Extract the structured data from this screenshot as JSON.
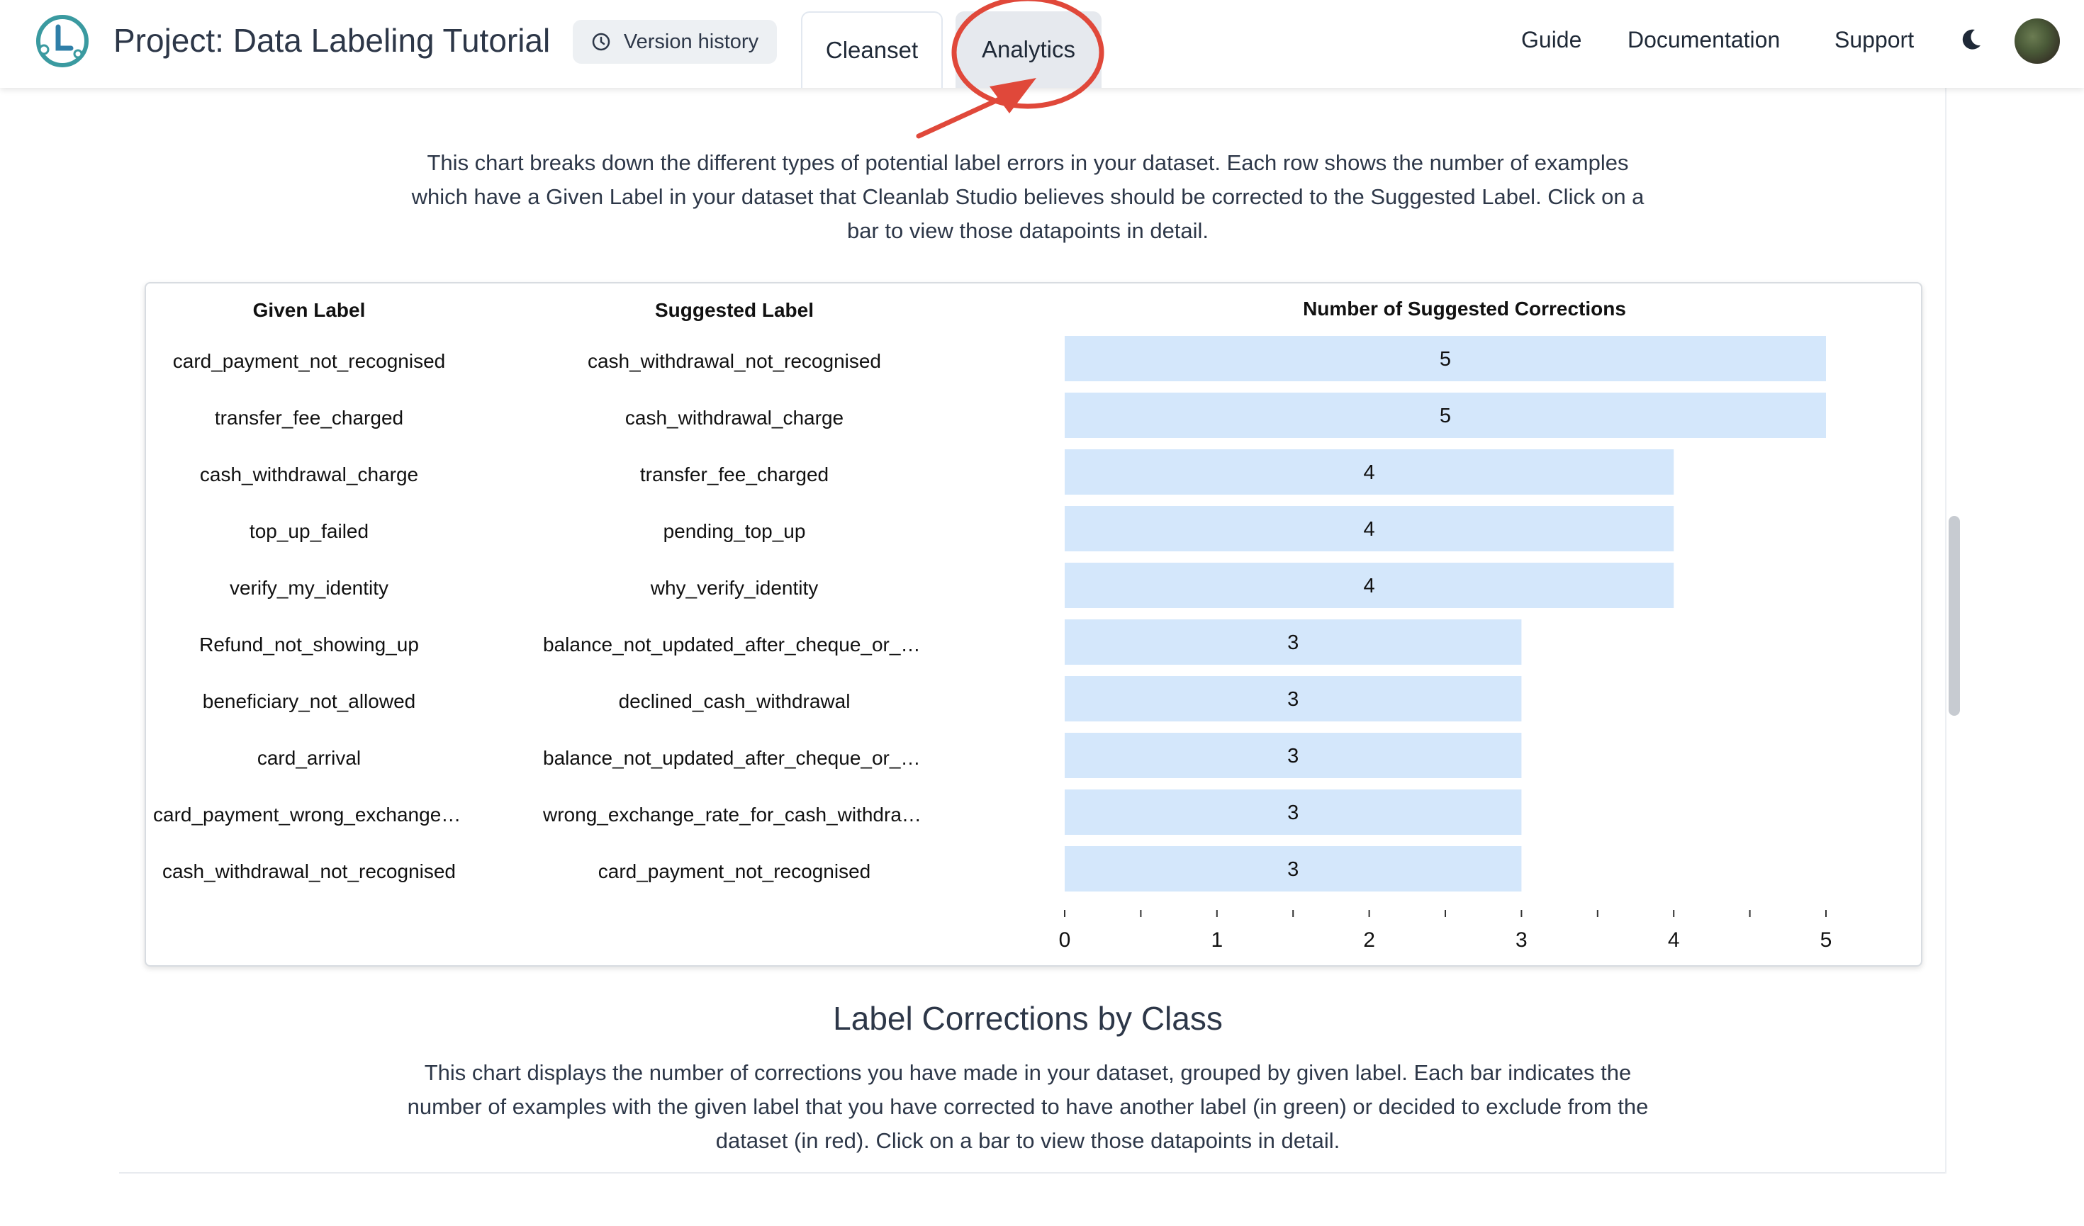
{
  "header": {
    "project_title": "Project: Data Labeling Tutorial",
    "version_history_label": "Version history",
    "tabs": [
      {
        "label": "Cleanset"
      },
      {
        "label": "Analytics"
      }
    ],
    "nav": {
      "guide": "Guide",
      "documentation": "Documentation",
      "support": "Support"
    }
  },
  "intro_text": "This chart breaks down the different types of potential label errors in your dataset. Each row shows the number of examples which have a Given Label in your dataset that Cleanlab Studio believes should be corrected to the Suggested Label. Click on a bar to view those datapoints in detail.",
  "table": {
    "headers": {
      "given": "Given Label",
      "suggested": "Suggested Label",
      "count": "Number of Suggested Corrections"
    },
    "rows": [
      {
        "given": "card_payment_not_recognised",
        "suggested": "cash_withdrawal_not_recognised",
        "count": 5
      },
      {
        "given": "transfer_fee_charged",
        "suggested": "cash_withdrawal_charge",
        "count": 5
      },
      {
        "given": "cash_withdrawal_charge",
        "suggested": "transfer_fee_charged",
        "count": 4
      },
      {
        "given": "top_up_failed",
        "suggested": "pending_top_up",
        "count": 4
      },
      {
        "given": "verify_my_identity",
        "suggested": "why_verify_identity",
        "count": 4
      },
      {
        "given": "Refund_not_showing_up",
        "suggested": "balance_not_updated_after_cheque_or_cash...",
        "count": 3
      },
      {
        "given": "beneficiary_not_allowed",
        "suggested": "declined_cash_withdrawal",
        "count": 3
      },
      {
        "given": "card_arrival",
        "suggested": "balance_not_updated_after_cheque_or_cash...",
        "count": 3
      },
      {
        "given": "card_payment_wrong_exchange_rate",
        "suggested": "wrong_exchange_rate_for_cash_withdrawal",
        "count": 3
      },
      {
        "given": "cash_withdrawal_not_recognised",
        "suggested": "card_payment_not_recognised",
        "count": 3
      }
    ]
  },
  "chart_data": {
    "type": "bar",
    "orientation": "horizontal",
    "title": "Number of Suggested Corrections",
    "categories": [
      "card_payment_not_recognised → cash_withdrawal_not_recognised",
      "transfer_fee_charged → cash_withdrawal_charge",
      "cash_withdrawal_charge → transfer_fee_charged",
      "top_up_failed → pending_top_up",
      "verify_my_identity → why_verify_identity",
      "Refund_not_showing_up → balance_not_updated_after_cheque_or_cash...",
      "beneficiary_not_allowed → declined_cash_withdrawal",
      "card_arrival → balance_not_updated_after_cheque_or_cash...",
      "card_payment_wrong_exchange_rate → wrong_exchange_rate_for_cash_withdrawal",
      "cash_withdrawal_not_recognised → card_payment_not_recognised"
    ],
    "values": [
      5,
      5,
      4,
      4,
      4,
      3,
      3,
      3,
      3,
      3
    ],
    "xlim": [
      0,
      5
    ],
    "xticks": [
      0,
      1,
      2,
      3,
      4,
      5
    ],
    "grid": false,
    "bar_color": "#d4e7fb"
  },
  "section2": {
    "title": "Label Corrections by Class",
    "description": "This chart displays the number of corrections you have made in your dataset, grouped by given label. Each bar indicates the number of examples with the given label that you have corrected to have another label (in green) or decided to exclude from the dataset (in red). Click on a bar to view those datapoints in detail."
  },
  "colors": {
    "bar": "#d4e7fb",
    "annotation": "#e0483a",
    "logo_teal": "#3a9aa0"
  }
}
